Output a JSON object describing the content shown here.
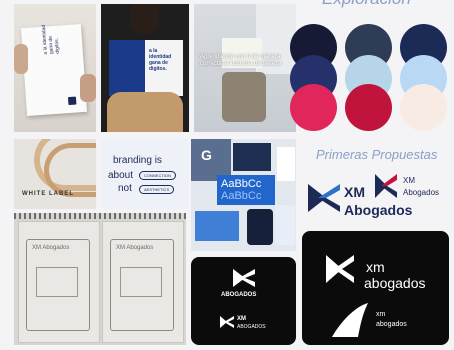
{
  "sections": {
    "exploration_heading": "Exploración",
    "proposals_heading": "Primeras Propuestas"
  },
  "palette": [
    {
      "name": "ink-navy",
      "hex": "#161a35"
    },
    {
      "name": "slate",
      "hex": "#2f3c55"
    },
    {
      "name": "midnight",
      "hex": "#1c2a56"
    },
    {
      "name": "indigo",
      "hex": "#26306a"
    },
    {
      "name": "sky-pale",
      "hex": "#b7d5e8"
    },
    {
      "name": "sky",
      "hex": "#b9d8f3"
    },
    {
      "name": "crimson",
      "hex": "#e0265a"
    },
    {
      "name": "burgundy",
      "hex": "#c0143c"
    },
    {
      "name": "cream",
      "hex": "#f8ebe3"
    }
  ],
  "moodboard": {
    "poster1_text": "a la identidad gana de digitos.",
    "poster2_text": "a la identidad gana de digitos.",
    "poster3_text": "Aprendiendo con ti de manera correcta la industria de belleza",
    "branding_card": {
      "line1": "branding is",
      "about": "about",
      "pill1": "CONNECTION",
      "not": "not",
      "pill2": "AESTHETICS"
    },
    "white_label": "WHITE LABEL",
    "type_sample": "AaBbCc",
    "sketch_note": "XM Abogados"
  },
  "proposals": {
    "logo1": {
      "xm": "XM",
      "abogados": "Abogados"
    },
    "logo2": {
      "xm": "XM",
      "abogados": "Abogados"
    },
    "card1": {
      "line1": "ABOGADOS",
      "line2_xm": "XM",
      "line2_abogados": "ABOGADOS"
    },
    "card2": {
      "xm": "xm",
      "abogados": "abogados",
      "small_xm": "xm",
      "small_abogados": "abogados"
    }
  }
}
